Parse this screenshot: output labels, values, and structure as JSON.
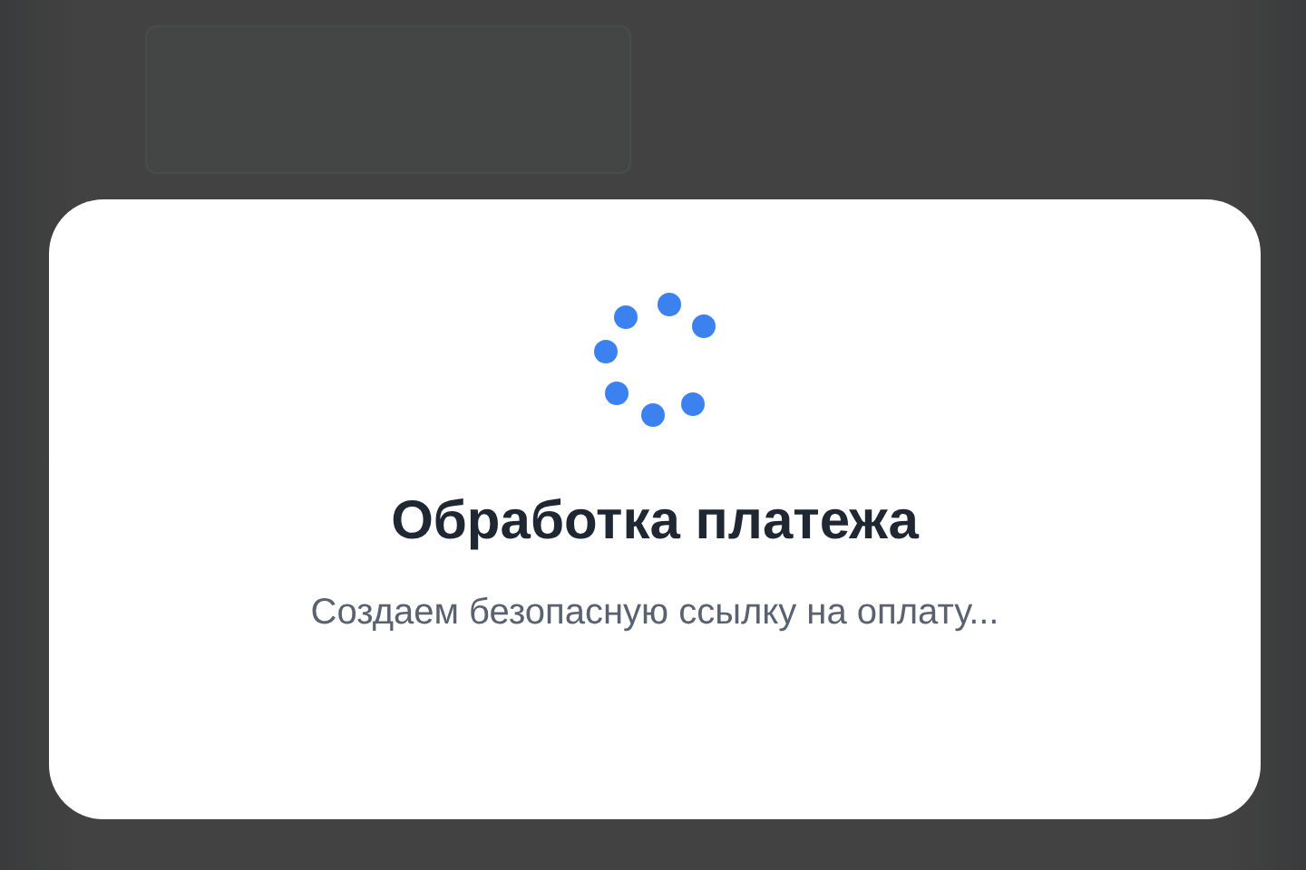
{
  "dialog": {
    "title": "Обработка платежа",
    "message": "Создаем безопасную ссылку на оплату..."
  }
}
